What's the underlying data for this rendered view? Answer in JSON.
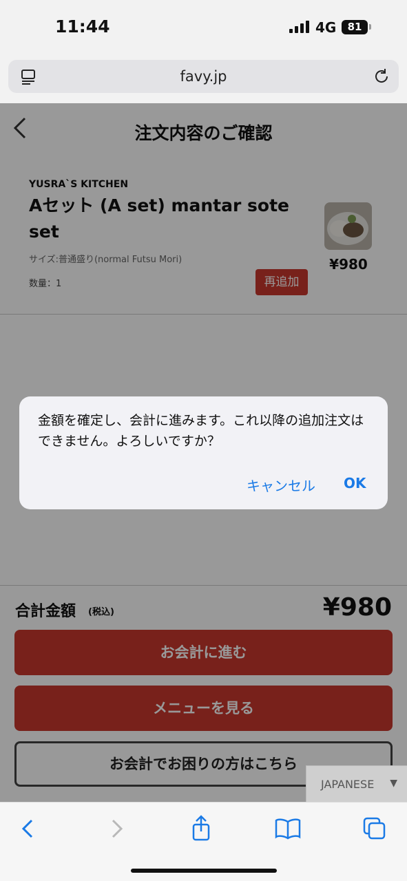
{
  "status_bar": {
    "time": "11:44",
    "network": "4G",
    "battery": "81"
  },
  "url_bar": {
    "url": "favy.jp"
  },
  "page": {
    "title": "注文内容のご確認",
    "item": {
      "shop": "YUSRA`S KITCHEN",
      "name": "Aセット (A set) mantar sote set",
      "size": "サイズ:普通盛り(normal Futsu Mori)",
      "quantity": "数量：1",
      "readd_label": "再追加",
      "price": "¥980"
    },
    "total": {
      "label": "合計金額",
      "tax_note": "(税込)",
      "price": "¥980"
    },
    "buttons": {
      "checkout": "お会計に進む",
      "menu": "メニューを見る",
      "help": "お会計でお困りの方はこちら"
    }
  },
  "dialog": {
    "message": "金額を確定し、会計に進みます。これ以降の追加注文はできません。よろしいですか？",
    "cancel": "キャンセル",
    "ok": "OK"
  },
  "language": {
    "selected": "JAPANESE",
    "arrow": "▼"
  },
  "colors": {
    "accent_red": "#c8372d",
    "ios_blue": "#1a7ae6"
  }
}
